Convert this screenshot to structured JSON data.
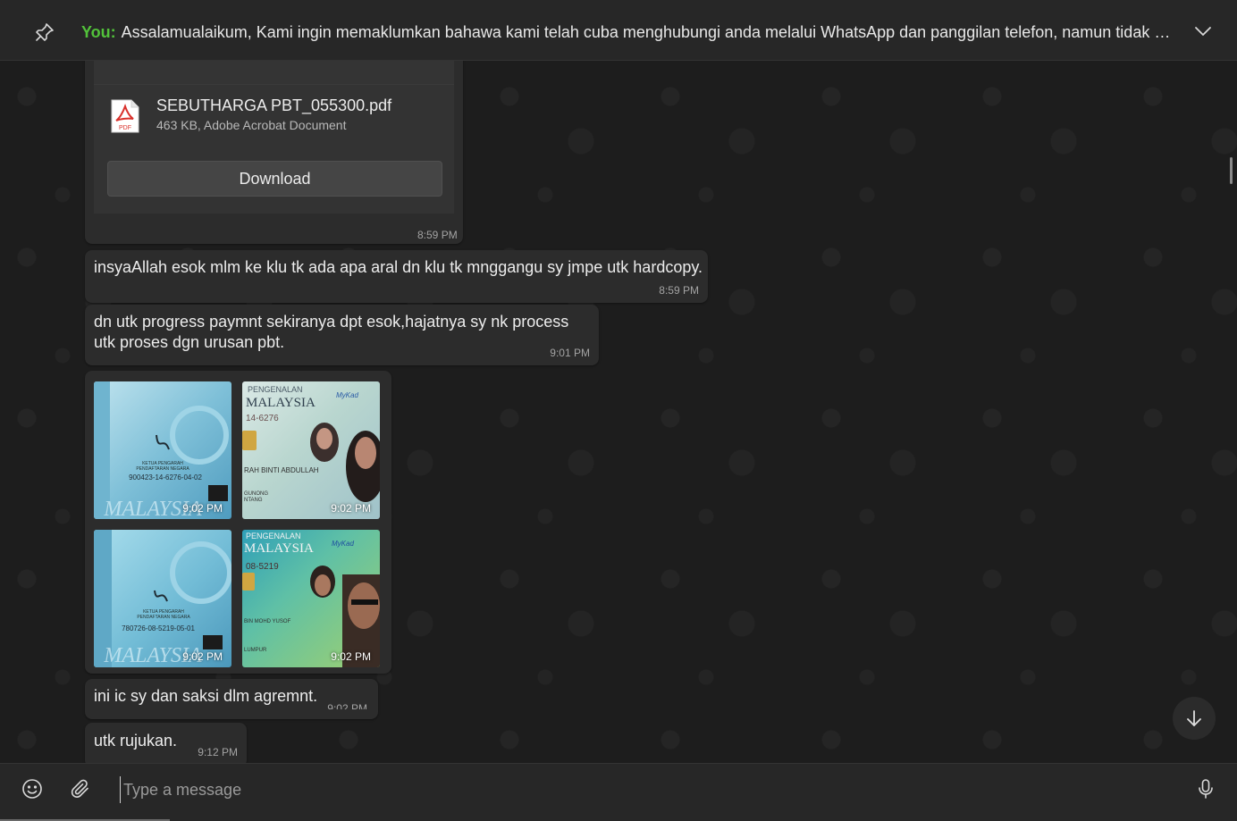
{
  "pinned": {
    "sender": "You:",
    "text": "Assalamualaikum,  Kami ingin memaklumkan bahawa kami telah cuba menghubungi anda melalui WhatsApp dan panggilan telefon, namun tidak mener..."
  },
  "messages": {
    "file": {
      "name": "SEBUTHARGA PBT_055300.pdf",
      "meta": "463 KB, Adobe Acrobat Document",
      "download_label": "Download",
      "time": "8:59 PM",
      "icon": "pdf-icon"
    },
    "m1": {
      "text": "insyaAllah esok mlm ke klu tk ada apa aral dn klu tk mnggangu sy jmpe utk hardcopy.",
      "time": "8:59 PM"
    },
    "m2": {
      "text": "dn utk progress paymnt sekiranya dpt esok,hajatnya sy nk process utk proses dgn urusan pbt.",
      "time": "9:01 PM"
    },
    "images": [
      {
        "time": "9:02 PM",
        "lines": [
          "KETUA PENGARAH",
          "PENDAFTARAN NEGARA",
          "900423-14-6276-04-02",
          "MALAYSIA"
        ]
      },
      {
        "time": "9:02 PM",
        "lines": [
          "PENGENALAN",
          "MALAYSIA",
          "MyKad",
          "14-6276",
          "RAH BINTI ABDULLAH",
          "GUNONG",
          "NTANG"
        ]
      },
      {
        "time": "9:02 PM",
        "lines": [
          "KETUA PENGARAH",
          "PENDAFTARAN NEGARA",
          "780726-08-5219-05-01",
          "MALAYSIA"
        ]
      },
      {
        "time": "9:02 PM",
        "lines": [
          "PENGENALAN",
          "MALAYSIA",
          "MyKad",
          "08-5219",
          "BIN MOHD YUSOF",
          "LUMPUR"
        ]
      }
    ],
    "m3": {
      "text": "ini ic sy dan saksi dlm agremnt.",
      "time": "9:02 PM"
    },
    "m4": {
      "text": "utk rujukan.",
      "time": "9:12 PM"
    }
  },
  "composer": {
    "placeholder": "Type a message",
    "emoji_icon": "emoji-icon",
    "attach_icon": "paperclip-icon",
    "mic_icon": "microphone-icon"
  },
  "colors": {
    "accent_you": "#52c23a",
    "bubble": "#2c2c2c",
    "background": "#1d1d1d"
  }
}
